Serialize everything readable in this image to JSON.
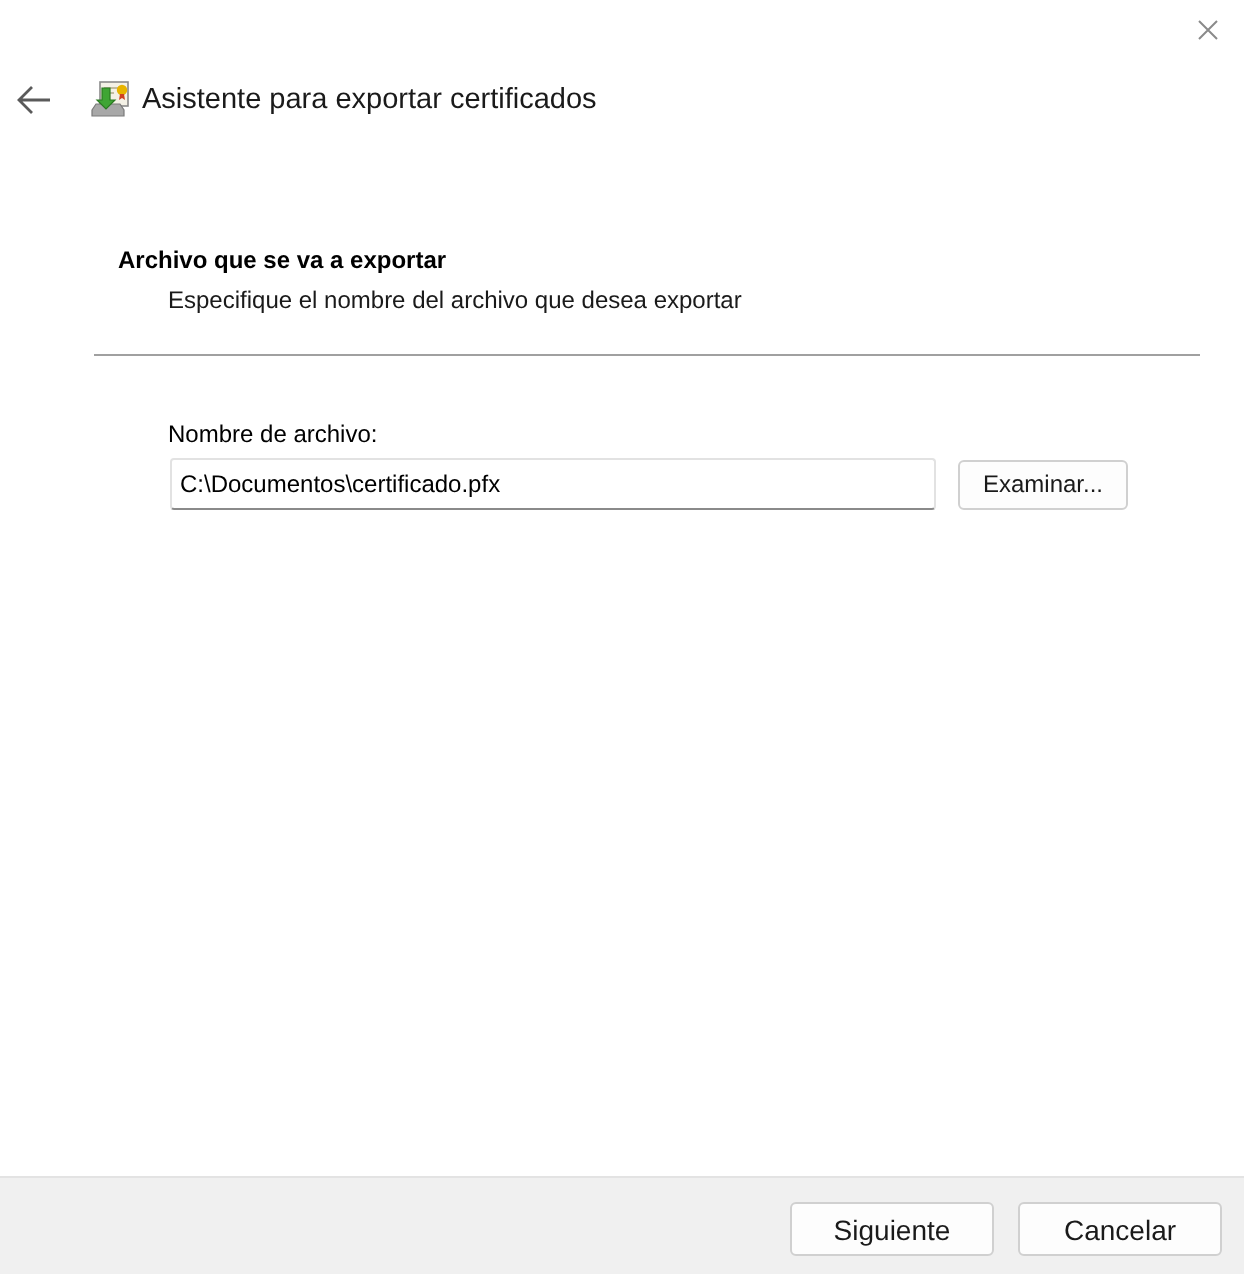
{
  "window": {
    "title": "Asistente para exportar certificados"
  },
  "page": {
    "heading": "Archivo que se va a exportar",
    "description": "Especifique el nombre del archivo que desea exportar"
  },
  "file_field": {
    "label": "Nombre de archivo:",
    "value": "C:\\Documentos\\certificado.pfx",
    "browse_button": "Examinar..."
  },
  "buttons": [
    "Siguiente",
    "Cancelar"
  ]
}
